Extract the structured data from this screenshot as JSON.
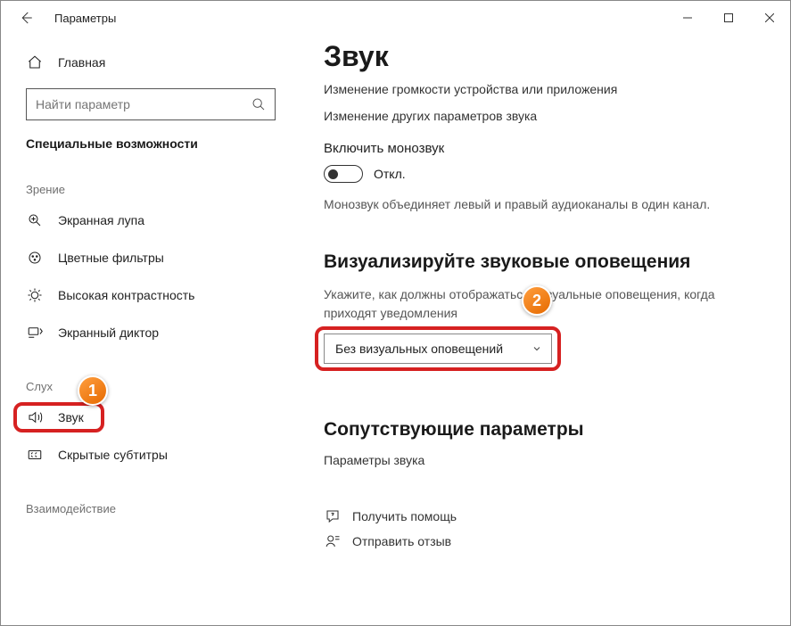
{
  "window": {
    "title": "Параметры"
  },
  "sidebar": {
    "home": "Главная",
    "search_placeholder": "Найти параметр",
    "category": "Специальные возможности",
    "groups": {
      "vision": {
        "label": "Зрение",
        "items": {
          "magnifier": "Экранная лупа",
          "color_filters": "Цветные фильтры",
          "high_contrast": "Высокая контрастность",
          "narrator": "Экранный диктор"
        }
      },
      "hearing": {
        "label": "Слух",
        "items": {
          "sound": "Звук",
          "captions": "Скрытые субтитры"
        }
      },
      "interaction": {
        "label": "Взаимодействие"
      }
    }
  },
  "main": {
    "title": "Звук",
    "link_volume": "Изменение громкости устройства или приложения",
    "link_other": "Изменение других параметров звука",
    "mono_heading": "Включить монозвук",
    "mono_state": "Откл.",
    "mono_desc": "Монозвук объединяет левый и правый аудиоканалы в один канал.",
    "visual_heading": "Визуализируйте звуковые оповещения",
    "visual_desc": "Укажите, как должны отображаться визуальные оповещения, когда приходят уведомления",
    "visual_value": "Без визуальных оповещений",
    "related_heading": "Сопутствующие параметры",
    "related_link": "Параметры звука",
    "help_link": "Получить помощь",
    "feedback_link": "Отправить отзыв"
  },
  "callouts": {
    "one": "1",
    "two": "2"
  }
}
